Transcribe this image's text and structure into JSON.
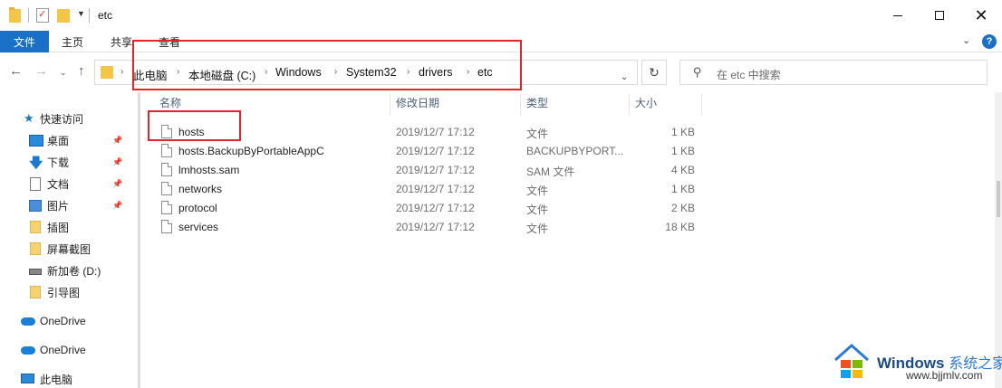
{
  "titlebar": {
    "title": "etc"
  },
  "ribbon": {
    "tabs": [
      {
        "label": "文件",
        "active": true
      },
      {
        "label": "主页"
      },
      {
        "label": "共享"
      },
      {
        "label": "查看"
      }
    ],
    "help_label": "?"
  },
  "address": {
    "crumbs": [
      "此电脑",
      "本地磁盘 (C:)",
      "Windows",
      "System32",
      "drivers",
      "etc"
    ]
  },
  "search": {
    "placeholder": "在 etc 中搜索"
  },
  "sidebar": {
    "quick_access": "快速访问",
    "items": [
      {
        "label": "桌面",
        "icon": "desktop-icon",
        "pinned": true
      },
      {
        "label": "下载",
        "icon": "download-icon",
        "pinned": true
      },
      {
        "label": "文档",
        "icon": "document-icon",
        "pinned": true
      },
      {
        "label": "图片",
        "icon": "picture-icon",
        "pinned": true
      },
      {
        "label": "插图",
        "icon": "folder-icon"
      },
      {
        "label": "屏幕截图",
        "icon": "folder-icon"
      },
      {
        "label": "新加卷 (D:)",
        "icon": "drive-icon"
      },
      {
        "label": "引导图",
        "icon": "folder-icon"
      }
    ],
    "onedrive_1": "OneDrive",
    "onedrive_2": "OneDrive",
    "this_pc": "此电脑"
  },
  "columns": {
    "name": "名称",
    "date": "修改日期",
    "type": "类型",
    "size": "大小"
  },
  "files": [
    {
      "name": "hosts",
      "date": "2019/12/7 17:12",
      "type": "文件",
      "size": "1 KB"
    },
    {
      "name": "hosts.BackupByPortableAppC",
      "date": "2019/12/7 17:12",
      "type": "BACKUPBYPORT...",
      "size": "1 KB"
    },
    {
      "name": "lmhosts.sam",
      "date": "2019/12/7 17:12",
      "type": "SAM 文件",
      "size": "4 KB"
    },
    {
      "name": "networks",
      "date": "2019/12/7 17:12",
      "type": "文件",
      "size": "1 KB"
    },
    {
      "name": "protocol",
      "date": "2019/12/7 17:12",
      "type": "文件",
      "size": "2 KB"
    },
    {
      "name": "services",
      "date": "2019/12/7 17:12",
      "type": "文件",
      "size": "18 KB"
    }
  ],
  "watermark": {
    "title": "Windows",
    "title_cn": "系统之家",
    "url": "www.bjjmlv.com"
  },
  "colors": {
    "accent": "#1a6fc7",
    "highlight": "#e0262b"
  }
}
